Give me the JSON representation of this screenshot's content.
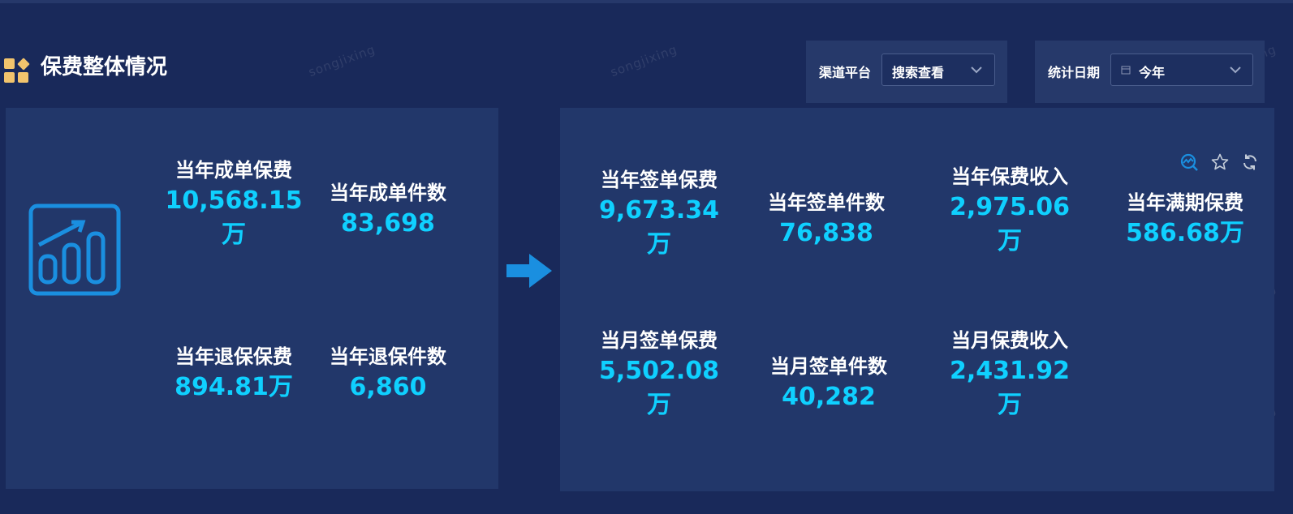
{
  "section": {
    "title": "保费整体情况"
  },
  "filters": {
    "channel": {
      "label": "渠道平台",
      "value": "搜索查看"
    },
    "date": {
      "label": "统计日期",
      "value": "今年"
    }
  },
  "left_panel": {
    "metrics": [
      {
        "label": "当年成单保费",
        "value": "10,568.15",
        "unit": "万"
      },
      {
        "label": "当年成单件数",
        "value": "83,698"
      },
      {
        "label": "当年退保保费",
        "value": "894.81万"
      },
      {
        "label": "当年退保件数",
        "value": "6,860"
      }
    ]
  },
  "right_panel": {
    "metrics": [
      {
        "label": "当年签单保费",
        "value": "9,673.34",
        "unit": "万"
      },
      {
        "label": "当年签单件数",
        "value": "76,838"
      },
      {
        "label": "当年保费收入",
        "value": "2,975.06",
        "unit": "万"
      },
      {
        "label": "当年满期保费",
        "value": "586.68万"
      },
      {
        "label": "当月签单保费",
        "value": "5,502.08",
        "unit": "万"
      },
      {
        "label": "当月签单件数",
        "value": "40,282"
      },
      {
        "label": "当月保费收入",
        "value": "2,431.92",
        "unit": "万"
      }
    ]
  },
  "toolbar_icons": [
    "analysis-icon",
    "star-icon",
    "refresh-icon"
  ],
  "watermark": "songjixing",
  "colors": {
    "background": "#19295a",
    "panel": "#22376a",
    "accent": "#0fd0ff",
    "arrow": "#1a8fe0"
  }
}
